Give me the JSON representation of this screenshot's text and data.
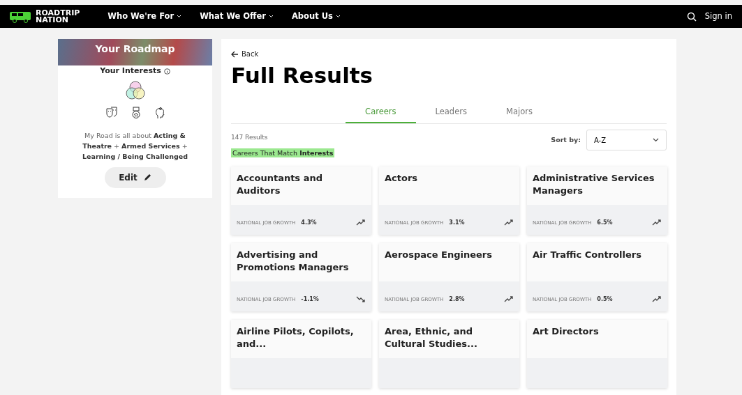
{
  "nav": {
    "logo_line1": "ROADTRIP",
    "logo_line2": "NATION",
    "menus": [
      "Who We're For",
      "What We Offer",
      "About Us"
    ],
    "sign_in": "Sign in"
  },
  "sidebar": {
    "banner": "Your Roadmap",
    "interests_title": "Your Interests",
    "summary": "My Road is all about **Acting & Theatre** + **Armed Services** + **Learning / Being Challenged**",
    "edit": "Edit"
  },
  "main": {
    "back": "Back",
    "title": "Full Results",
    "tabs": [
      {
        "label": "Careers",
        "selected": true
      },
      {
        "label": "Leaders",
        "selected": false
      },
      {
        "label": "Majors",
        "selected": false
      }
    ],
    "count": "147 Results",
    "sort_label": "Sort by:",
    "sort_value": "A-Z",
    "match_label": "Careers That Match **Interests**",
    "careers": [
      {
        "title": "Accountants and Auditors",
        "growth_label": "NATIONAL JOB GROWTH",
        "growth": "4.3%",
        "kind": "up"
      },
      {
        "title": "Actors",
        "growth_label": "NATIONAL JOB GROWTH",
        "growth": "3.1%",
        "kind": "up"
      },
      {
        "title": "Administrative Services Managers",
        "growth_label": "NATIONAL JOB GROWTH",
        "growth": "6.5%",
        "kind": "up"
      },
      {
        "title": "Advertising and Promotions Managers",
        "growth_label": "NATIONAL JOB GROWTH",
        "growth": "-1.1%",
        "kind": "down"
      },
      {
        "title": "Aerospace Engineers",
        "growth_label": "NATIONAL JOB GROWTH",
        "growth": "2.8%",
        "kind": "up"
      },
      {
        "title": "Air Traffic Controllers",
        "growth_label": "NATIONAL JOB GROWTH",
        "growth": "0.5%",
        "kind": "up"
      },
      {
        "title": "Airline Pilots, Copilots, and..."
      },
      {
        "title": "Area, Ethnic, and Cultural Studies..."
      },
      {
        "title": "Art Directors"
      }
    ]
  }
}
